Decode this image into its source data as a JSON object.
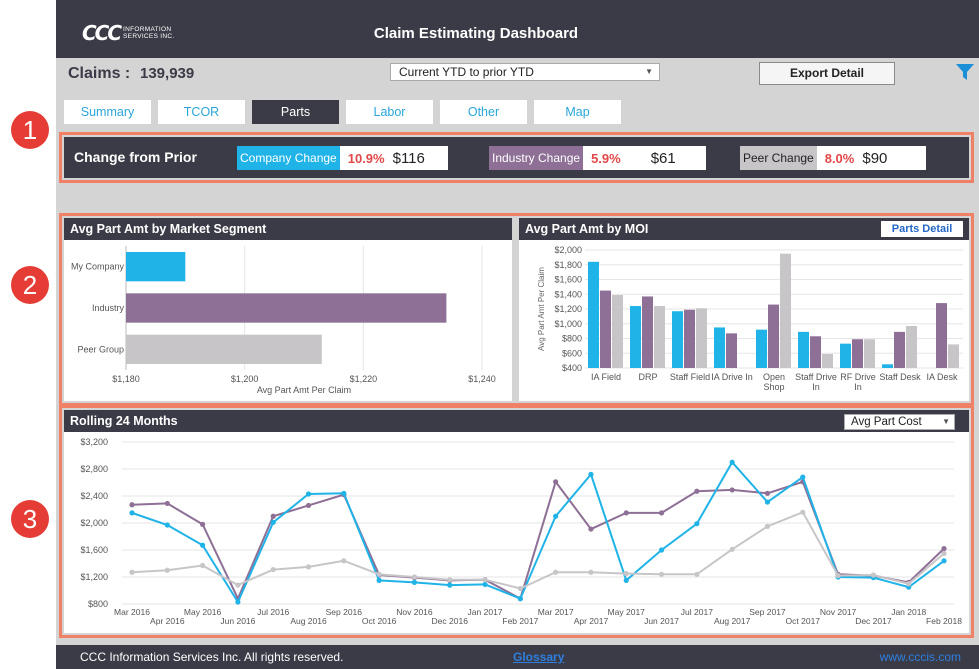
{
  "header": {
    "logo_mark": "CCC",
    "logo_text_line1": "INFORMATION",
    "logo_text_line2": "SERVICES INC.",
    "title": "Claim Estimating Dashboard"
  },
  "claims": {
    "label": "Claims :",
    "value": "139,939",
    "period_select": "Current YTD to prior YTD",
    "export_label": "Export Detail"
  },
  "tabs": [
    {
      "label": "Summary",
      "active": false
    },
    {
      "label": "TCOR",
      "active": false
    },
    {
      "label": "Parts",
      "active": true
    },
    {
      "label": "Labor",
      "active": false
    },
    {
      "label": "Other",
      "active": false
    },
    {
      "label": "Map",
      "active": false
    }
  ],
  "markers": [
    "1",
    "2",
    "3"
  ],
  "change": {
    "title": "Change from Prior",
    "items": [
      {
        "label": "Company Change",
        "pct": "10.9%",
        "amt": "$116",
        "color": "#1fb3e8"
      },
      {
        "label": "Industry Change",
        "pct": "5.9%",
        "amt": "$61",
        "color": "#8e6f96"
      },
      {
        "label": "Peer Change",
        "pct": "8.0%",
        "amt": "$90",
        "color": "#c8c5c9"
      }
    ]
  },
  "colors": {
    "company": "#1fb3e8",
    "industry": "#8e6f96",
    "peer": "#c8c5c9",
    "header": "#3b3b47",
    "accent_red": "#e44848",
    "outline": "#f08066"
  },
  "chart_data": [
    {
      "type": "bar",
      "orientation": "horizontal",
      "title": "Avg Part Amt by Market Segment",
      "xlabel": "Avg Part Amt Per Claim",
      "ylabel": "",
      "categories": [
        "My Company",
        "Industry",
        "Peer Group"
      ],
      "values": [
        1190,
        1234,
        1213
      ],
      "xlim": [
        1180,
        1240
      ],
      "xticks": [
        "$1,180",
        "$1,200",
        "$1,220",
        "$1,240"
      ],
      "grid": true
    },
    {
      "type": "bar",
      "title": "Avg Part Amt by MOI",
      "button_label": "Parts Detail",
      "xlabel": "",
      "ylabel": "Avg Part Amt Per Claim",
      "categories": [
        [
          "IA Field"
        ],
        [
          "DRP"
        ],
        [
          "Staff Field"
        ],
        [
          "IA Drive In"
        ],
        [
          "Open",
          "Shop"
        ],
        [
          "Staff Drive",
          "In"
        ],
        [
          "RF Drive",
          "In"
        ],
        [
          "Staff Desk"
        ],
        [
          "IA Desk"
        ]
      ],
      "series": [
        {
          "values": [
            1840,
            1240,
            1170,
            950,
            920,
            890,
            730,
            450,
            1
          ]
        },
        {
          "values": [
            1450,
            1370,
            1190,
            870,
            1260,
            830,
            790,
            890,
            1280
          ]
        },
        {
          "values": [
            1390,
            1240,
            1210,
            1,
            1950,
            590,
            790,
            970,
            720
          ]
        }
      ],
      "ylim": [
        400,
        2000
      ],
      "yticks": [
        "$400",
        "$600",
        "$800",
        "$1,000",
        "$1,200",
        "$1,400",
        "$1,600",
        "$1,800",
        "$2,000"
      ],
      "grid": true
    },
    {
      "type": "line",
      "title": "Rolling 24 Months",
      "measure_select": "Avg Part Cost",
      "xlabel": "",
      "ylabel": "",
      "x": [
        "Mar 2016",
        "Apr 2016",
        "May 2016",
        "Jun 2016",
        "Jul 2016",
        "Aug 2016",
        "Sep 2016",
        "Oct 2016",
        "Nov 2016",
        "Dec 2016",
        "Jan 2017",
        "Feb 2017",
        "Mar 2017",
        "Apr 2017",
        "May 2017",
        "Jun 2017",
        "Jul 2017",
        "Aug 2017",
        "Sep 2017",
        "Oct 2017",
        "Nov 2017",
        "Dec 2017",
        "Jan 2018",
        "Feb 2018"
      ],
      "series": [
        {
          "values": [
            2150,
            1970,
            1670,
            830,
            2010,
            2430,
            2440,
            1150,
            1120,
            1080,
            1090,
            880,
            2100,
            2720,
            1150,
            1600,
            1990,
            2900,
            2310,
            2680,
            1200,
            1190,
            1050,
            1440
          ]
        },
        {
          "values": [
            2270,
            2290,
            1980,
            880,
            2100,
            2260,
            2420,
            1230,
            1190,
            1150,
            1160,
            880,
            2610,
            1910,
            2150,
            2150,
            2470,
            2490,
            2440,
            2610,
            1240,
            1220,
            1120,
            1620
          ]
        },
        {
          "values": [
            1270,
            1300,
            1370,
            1080,
            1310,
            1350,
            1440,
            1240,
            1200,
            1160,
            1160,
            1030,
            1270,
            1270,
            1250,
            1240,
            1240,
            1610,
            1950,
            2160,
            1220,
            1230,
            1100,
            1550
          ]
        }
      ],
      "ylim": [
        800,
        3200
      ],
      "yticks": [
        "$800",
        "$1,200",
        "$1,600",
        "$2,000",
        "$2,400",
        "$2,800",
        "$3,200"
      ],
      "grid": true
    }
  ],
  "footer": {
    "copyright": "CCC Information Services Inc. All rights reserved.",
    "glossary": "Glossary",
    "site": "www.cccis.com"
  }
}
